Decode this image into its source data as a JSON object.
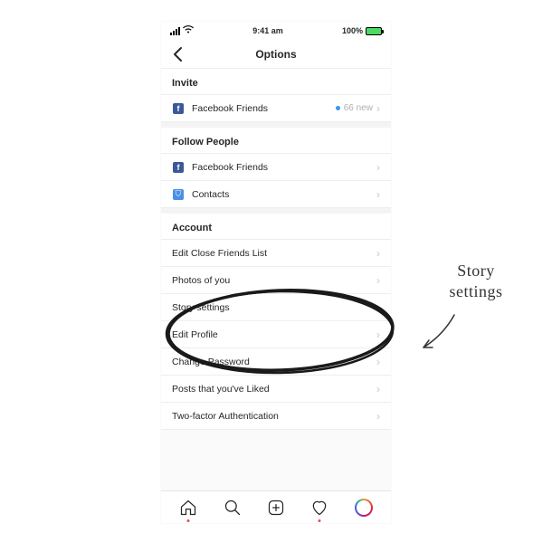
{
  "status_bar": {
    "time": "9:41 am",
    "battery": "100%"
  },
  "nav": {
    "title": "Options"
  },
  "sections": {
    "invite": {
      "header": "Invite",
      "fb_friends": {
        "label": "Facebook Friends",
        "badge": "66 new"
      }
    },
    "follow": {
      "header": "Follow People",
      "fb_friends": {
        "label": "Facebook Friends"
      },
      "contacts": {
        "label": "Contacts"
      }
    },
    "account": {
      "header": "Account",
      "items": [
        {
          "label": "Edit Close Friends List"
        },
        {
          "label": "Photos of you"
        },
        {
          "label": "Story settings"
        },
        {
          "label": "Edit Profile"
        },
        {
          "label": "Change Password"
        },
        {
          "label": "Posts that you've Liked"
        },
        {
          "label": "Two-factor Authentication"
        }
      ]
    }
  },
  "annotation": {
    "line1": "Story",
    "line2": "settings"
  }
}
